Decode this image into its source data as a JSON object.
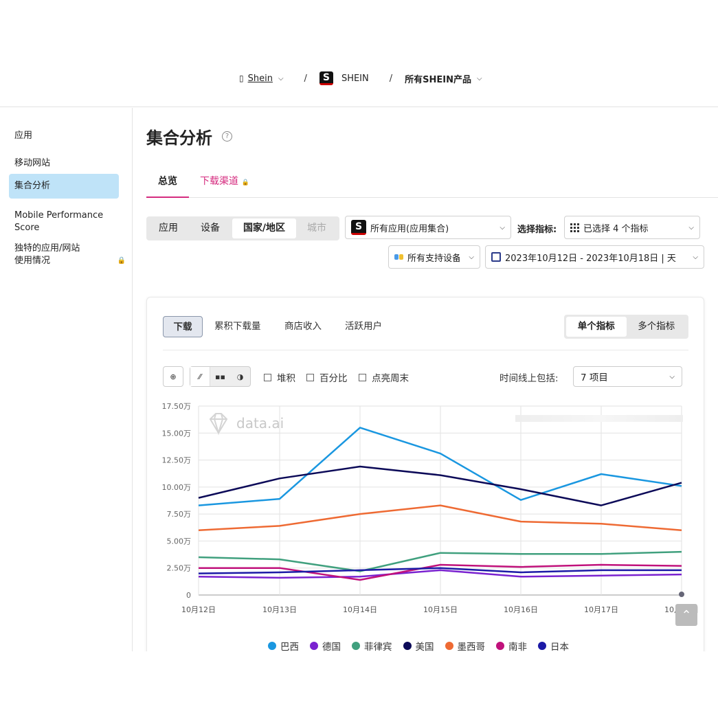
{
  "header": {
    "org": "Shein",
    "app": "SHEIN",
    "app_icon_letter": "S",
    "product": "所有SHEIN产品",
    "separator": "/"
  },
  "sidebar": {
    "items": [
      {
        "label": "应用"
      },
      {
        "label": "移动网站"
      },
      {
        "label": "集合分析"
      },
      {
        "label": "Mobile Performance Score"
      },
      {
        "label": "独特的应用/网站使用情况"
      }
    ]
  },
  "page": {
    "title": "集合分析",
    "help_icon": "?",
    "tabs": [
      {
        "label": "总览"
      },
      {
        "label": "下载渠道"
      }
    ]
  },
  "filters": {
    "scope_segments": [
      "应用",
      "设备",
      "国家/地区",
      "城市"
    ],
    "app_select": "所有应用(应用集合)",
    "metric_label": "选择指标:",
    "metric_select": "已选择 4 个指标",
    "device_select": "所有支持设备",
    "date_range": "2023年10月12日 - 2023年10月18日 | 天"
  },
  "card": {
    "metric_tabs": [
      "下载",
      "累积下载量",
      "商店收入",
      "活跃用户"
    ],
    "mode_segments": [
      "单个指标",
      "多个指标"
    ],
    "options": [
      "堆积",
      "百分比",
      "点亮周末"
    ],
    "timeline_label": "时间线上包括:",
    "timeline_select": "7 项目",
    "watermark": "data.ai"
  },
  "chart_data": {
    "type": "line",
    "x": [
      "10月12日",
      "10月13日",
      "10月14日",
      "10月15日",
      "10月16日",
      "10月17日",
      "10月18日"
    ],
    "y_ticks": [
      "0",
      "2.50万",
      "5.00万",
      "7.50万",
      "10.00万",
      "12.50万",
      "15.00万",
      "17.50万"
    ],
    "ylim": [
      0,
      175000
    ],
    "grid": true,
    "legend_position": "bottom",
    "series": [
      {
        "name": "巴西",
        "color": "#1a97e0",
        "values": [
          83000,
          89000,
          155000,
          131000,
          88000,
          112000,
          101000
        ]
      },
      {
        "name": "德国",
        "color": "#7a22d0",
        "values": [
          17000,
          16000,
          17000,
          23000,
          17000,
          18000,
          19000
        ]
      },
      {
        "name": "菲律宾",
        "color": "#40a07e",
        "values": [
          35000,
          33000,
          22000,
          39000,
          38000,
          38000,
          40000
        ]
      },
      {
        "name": "美国",
        "color": "#0c0a58",
        "values": [
          90000,
          108000,
          119000,
          111000,
          98000,
          83000,
          104000
        ]
      },
      {
        "name": "墨西哥",
        "color": "#ee6a33",
        "values": [
          60000,
          64000,
          75000,
          83000,
          68000,
          66000,
          60000
        ]
      },
      {
        "name": "南非",
        "color": "#c0117b",
        "values": [
          25000,
          25000,
          14000,
          28000,
          26000,
          28000,
          27000
        ]
      },
      {
        "name": "日本",
        "color": "#1c1aa6",
        "values": [
          20000,
          21000,
          23000,
          25000,
          21000,
          23000,
          23000
        ]
      }
    ]
  }
}
